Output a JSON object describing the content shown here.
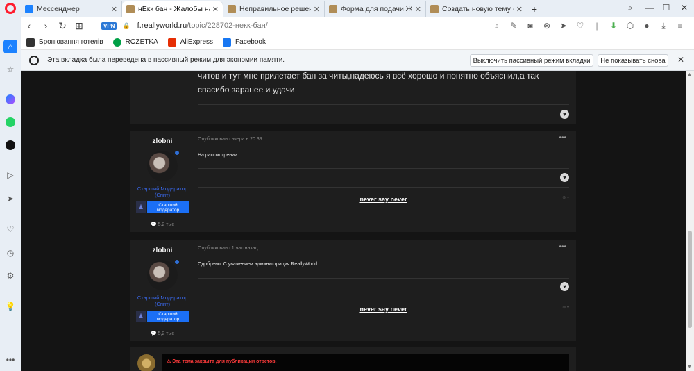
{
  "tabs": [
    {
      "label": "Мессенджер",
      "color": "#1c82ff",
      "active": false
    },
    {
      "label": "нЕкк бан - Жалобы на Адм",
      "color": "#b08d57",
      "active": true
    },
    {
      "label": "Неправильное решение а",
      "color": "#b08d57",
      "active": false
    },
    {
      "label": "Форма для подачи Жалоб",
      "color": "#b08d57",
      "active": false
    },
    {
      "label": "Создать новую тему - Rea",
      "color": "#b08d57",
      "active": false
    }
  ],
  "window": {
    "newtab": "+",
    "search": "⌕",
    "minimize": "—",
    "maximize": "☐",
    "close": "✕"
  },
  "address": {
    "vpn": "VPN",
    "domain": "f.reallyworld.ru",
    "path": "/topic/228702-некк-бан/"
  },
  "nav": {
    "back": "‹",
    "forward": "›",
    "reload": "↻",
    "grid": "⊞"
  },
  "bookmarks": [
    {
      "label": "Бронювання готелів",
      "icon_color": "#333333"
    },
    {
      "label": "ROZETKA",
      "icon_color": "#00a046"
    },
    {
      "label": "AliExpress",
      "icon_color": "#e62e04"
    },
    {
      "label": "Facebook",
      "icon_color": "#1877f2"
    }
  ],
  "infobar": {
    "text": "Эта вкладка была переведена в пассивный режим для экономии памяти.",
    "disable_button": "Выключить пассивный режим вкладки",
    "dont_show_button": "Не показывать снова",
    "close": "✕"
  },
  "first_post_text": {
    "line1": "читов и тут мне прилетает бан за читы,надеюсь я всё хорошо и понятно объяснил,а так",
    "line2": "спасибо заранее и удачи"
  },
  "posts": [
    {
      "username": "zlobni",
      "role_line1": "Старший Модератор",
      "role_line2": "(Спит)",
      "rank_label": "Старший модератор",
      "reputation": "💬 5,2 тыс",
      "meta": "Опубликовано вчера в 20:39",
      "text": "На рассмотрении.",
      "signature": "never say never",
      "dots": "•••"
    },
    {
      "username": "zlobni",
      "role_line1": "Старший Модератор",
      "role_line2": "(Спит)",
      "rank_label": "Старший модератор",
      "reputation": "💬 5,2 тыс",
      "meta": "Опубликовано 1 час назад",
      "text": "Одобрено. С уважением администрация ReallyWorld.",
      "signature": "never say never",
      "dots": "•••"
    }
  ],
  "closed_notice": "⚠ Эта тема закрыта для публикации ответов.",
  "colors": {
    "accent": "#1c82ff",
    "opera_red": "#ff1b2d",
    "page_bg": "#141414",
    "post_bg": "#1e1e1e",
    "rank_blue": "#1b6ff5",
    "role_blue": "#3b6cf5",
    "closed_red": "#ff3b3b"
  }
}
